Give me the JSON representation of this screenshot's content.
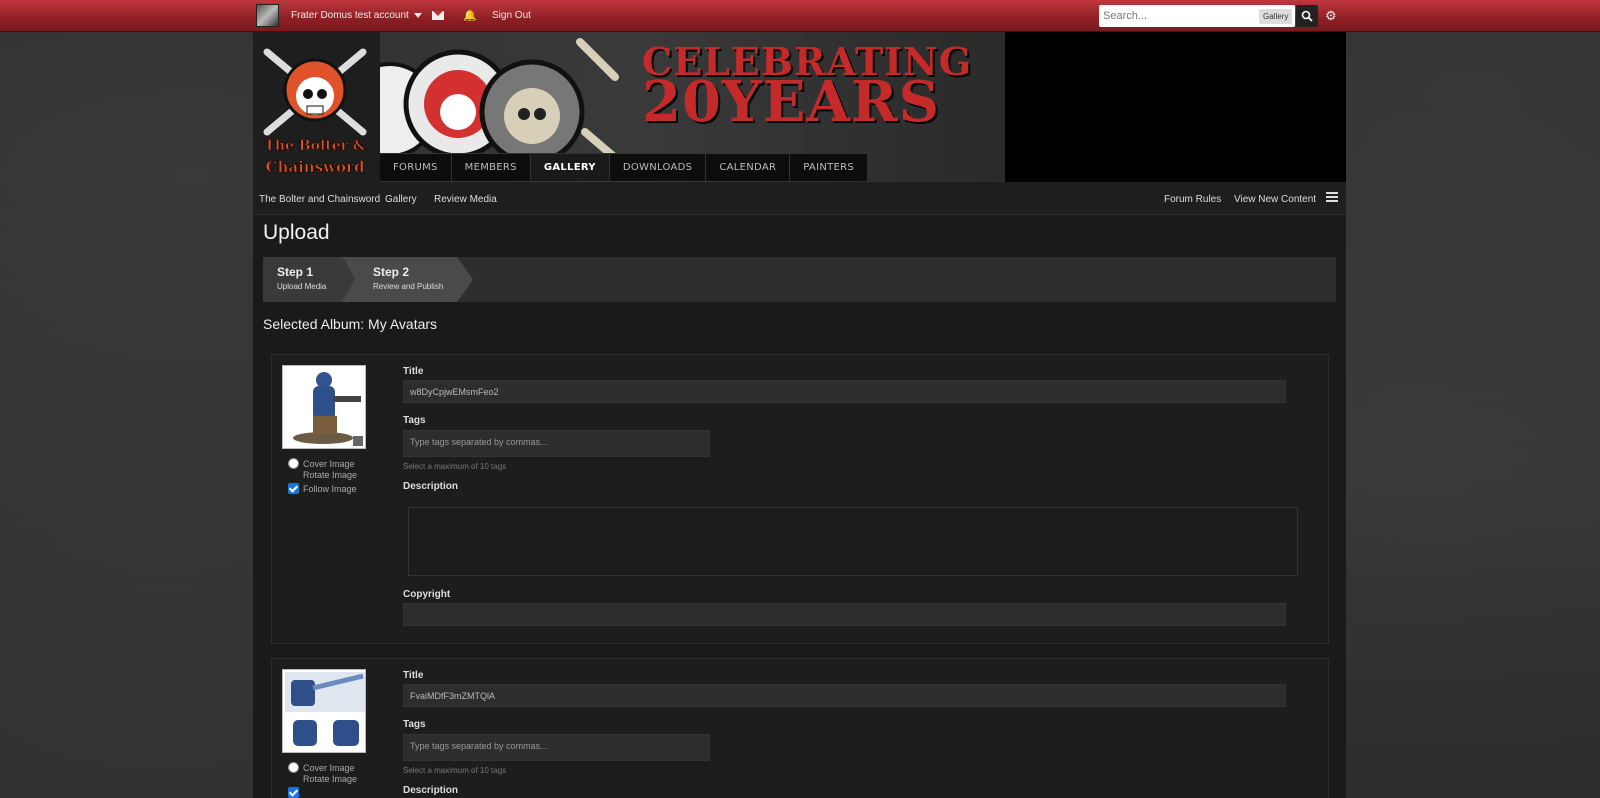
{
  "topbar": {
    "account_name": "Frater Domus test account",
    "sign_out": "Sign Out",
    "search_placeholder": "Search...",
    "search_scope": "Gallery"
  },
  "banner": {
    "line1": "CELEBRATING",
    "line2": "20YEARS",
    "logo_text": "The Bolter & Chainsword"
  },
  "nav": {
    "items": [
      "FORUMS",
      "MEMBERS",
      "GALLERY",
      "DOWNLOADS",
      "CALENDAR",
      "PAINTERS"
    ],
    "active": "GALLERY"
  },
  "breadcrumb": {
    "items": [
      "The Bolter and Chainsword",
      "Gallery",
      "Review Media"
    ],
    "right": [
      "Forum Rules",
      "View New Content"
    ]
  },
  "page": {
    "title": "Upload",
    "album": "Selected Album: My Avatars"
  },
  "steps": [
    {
      "num": "Step 1",
      "label": "Upload Media"
    },
    {
      "num": "Step 2",
      "label": "Review and Publish"
    }
  ],
  "options": {
    "cover": "Cover Image",
    "rotate": "Rotate Image",
    "follow": "Follow Image"
  },
  "form_labels": {
    "title": "Title",
    "tags": "Tags",
    "tags_placeholder": "Type tags separated by commas...",
    "tags_hint": "Select a maximum of 10 tags",
    "description": "Description",
    "copyright": "Copyright"
  },
  "media": [
    {
      "title": "w8DyCpjwEMsmFeo2",
      "follow_checked": true
    },
    {
      "title": "FvaiMDfF3mZMTQlA",
      "follow_checked": true
    }
  ],
  "colors": {
    "topbar": "#a52a2f",
    "accent_check": "#1a73e8",
    "banner_text": "#c42a2a"
  }
}
